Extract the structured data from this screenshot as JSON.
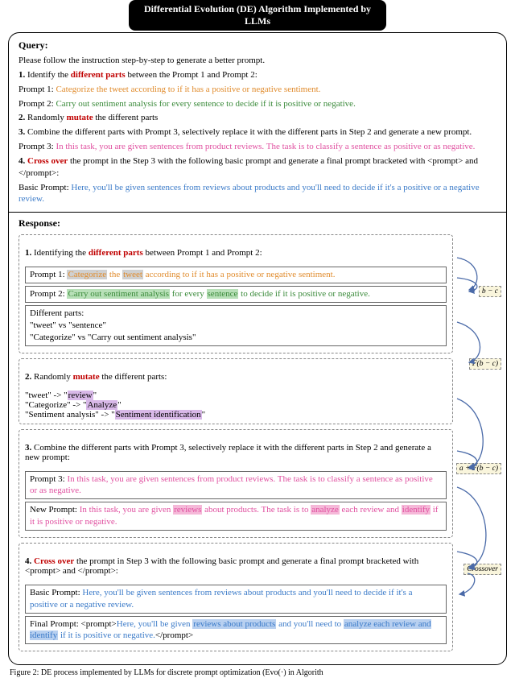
{
  "title": "Differential Evolution (DE) Algorithm Implemented by LLMs",
  "query": {
    "label": "Query:",
    "intro": "Please follow the instruction step-by-step to generate a better prompt.",
    "step1_prefix": "1.",
    "step1_text_a": " Identify the ",
    "step1_red": "different parts",
    "step1_text_b": " between the Prompt 1 and Prompt 2:",
    "p1_label": "Prompt 1: ",
    "p1_text": "Categorize the tweet according to if it has a positive or negative sentiment.",
    "p2_label": "Prompt 2: ",
    "p2_text": "Carry out sentiment analysis for every sentence to decide if it is positive or negative.",
    "step2_prefix": "2.",
    "step2_text_a": " Randomly ",
    "step2_red": "mutate",
    "step2_text_b": " the different parts",
    "step3_prefix": "3.",
    "step3_text": " Combine the different parts with Prompt 3, selectively replace it with the different parts in Step 2 and generate a new prompt.",
    "p3_label": "Prompt 3: ",
    "p3_text": "In this task, you are given sentences from product reviews. The task is to classify a sentence as  positive or as negative.",
    "step4_prefix": "4.",
    "step4_red": "Cross over",
    "step4_text": " the prompt in the Step 3 with the following basic prompt and generate a final prompt bracketed with <prompt> and </prompt>:",
    "bp_label": "Basic Prompt: ",
    "bp_text": "Here, you'll be given sentences from reviews about products and you'll need to decide if it's a positive or a negative review."
  },
  "response": {
    "label": "Response:",
    "s1_prefix": "1.",
    "s1_a": " Identifying the ",
    "s1_red": "different parts",
    "s1_b": " between Prompt 1 and Prompt 2:",
    "s1_p1_pre": "Prompt 1: ",
    "s1_p1_cat": "Categorize",
    "s1_p1_mid1": " the ",
    "s1_p1_tweet": "tweet",
    "s1_p1_rest": " according to if it has a positive or negative sentiment.",
    "s1_p2_pre": "Prompt 2: ",
    "s1_p2_carry": "Carry out sentiment analysis",
    "s1_p2_mid": " for every ",
    "s1_p2_sent": "sentence",
    "s1_p2_rest": " to decide if it is positive or negative.",
    "s1_diff_label": "Different parts:",
    "s1_diff1": "\"tweet\" vs \"sentence\"",
    "s1_diff2": "\"Categorize\" vs \"Carry out sentiment analysis\"",
    "s2_prefix": "2.",
    "s2_a": " Randomly ",
    "s2_red": "mutate",
    "s2_b": " the different parts:",
    "s2_m1a": "\"tweet\" -> \"",
    "s2_m1b": "review",
    "s2_m1c": "\"",
    "s2_m2a": "\"Categorize\" -> \"",
    "s2_m2b": "Analyze",
    "s2_m2c": "\"",
    "s2_m3a": "\"Sentiment analysis\" -> \"",
    "s2_m3b": "Sentiment identification",
    "s2_m3c": "\"",
    "s3_prefix": "3.",
    "s3_text": " Combine the different parts with Prompt 3, selectively replace it with the different parts in Step 2 and generate a new prompt:",
    "s3_p3_pre": "Prompt 3: ",
    "s3_p3_text": "In this task, you are given sentences from product reviews. The task is to classify a sentence as  positive or as negative.",
    "s3_np_pre": "New Prompt: ",
    "s3_np_a": "In this task, you are given ",
    "s3_np_rev": "reviews",
    "s3_np_b": " about products. The task is to ",
    "s3_np_ana": "analyze",
    "s3_np_c": " each review and ",
    "s3_np_id": "identify",
    "s3_np_d": " if it is positive or negative.",
    "s4_prefix": "4.",
    "s4_red": "Cross over",
    "s4_text": " the prompt in Step 3 with the following basic prompt and generate a final prompt bracketed with <prompt> and </prompt>:",
    "s4_bp_pre": "Basic Prompt: ",
    "s4_bp_text": "Here, you'll be given sentences from reviews about products and you'll need to decide if it's a positive or a negative review.",
    "s4_fp_pre": "Final Prompt: <prompt>",
    "s4_fp_a": "Here, you'll be given ",
    "s4_fp_rev": "reviews about products",
    "s4_fp_b": " and you'll need to ",
    "s4_fp_ana": "analyze each review and identify",
    "s4_fp_c": " if it is positive or negative.",
    "s4_fp_close": "</prompt>"
  },
  "side": {
    "bc": "b − c",
    "fbc": "F(b − c)",
    "afbc": "a + F(b − c)",
    "cross": "Crossover"
  },
  "caption": "Figure 2: DE process implemented by LLMs for discrete prompt optimization (Evo(·) in Algorith"
}
